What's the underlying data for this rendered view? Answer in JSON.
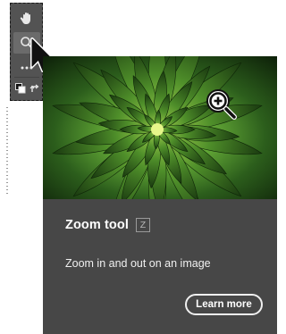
{
  "toolbar": {
    "tools": [
      {
        "icon": "hand-icon"
      },
      {
        "icon": "zoom-icon",
        "selected": true
      },
      {
        "icon": "more-icon"
      },
      {
        "icon": "default-colors-icon"
      },
      {
        "icon": "swap-colors-icon"
      }
    ]
  },
  "tooltip": {
    "title": "Zoom tool",
    "shortcut": "Z",
    "description": "Zoom in and out on an image",
    "button_label": "Learn more",
    "image_icon": "zoom-in-icon"
  },
  "colors": {
    "toolbar_bg": "#535353",
    "card_bg": "#474747",
    "text": "#ffffff"
  }
}
